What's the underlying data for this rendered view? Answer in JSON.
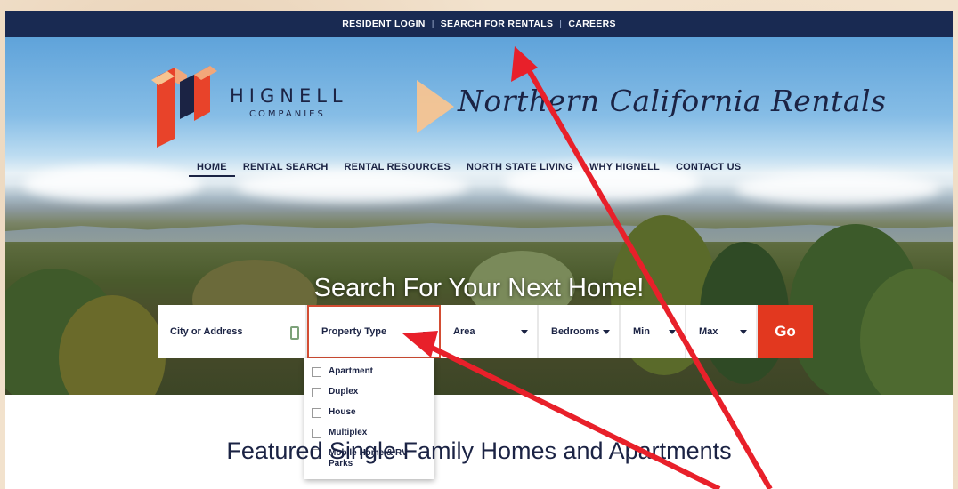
{
  "topbar": {
    "links": [
      "RESIDENT LOGIN",
      "SEARCH FOR RENTALS",
      "CAREERS"
    ],
    "separator": "|"
  },
  "brand": {
    "name": "HIGNELL",
    "sub": "COMPANIES",
    "tagline": "Northern California Rentals"
  },
  "nav": {
    "items": [
      "HOME",
      "RENTAL SEARCH",
      "RENTAL RESOURCES",
      "NORTH STATE LIVING",
      "WHY HIGNELL",
      "CONTACT US"
    ],
    "active": "HOME"
  },
  "hero": {
    "title": "Search For Your Next Home!"
  },
  "search": {
    "city_label": "City or Address",
    "type_label": "Property Type",
    "area_label": "Area",
    "bedrooms_label": "Bedrooms",
    "min_label": "Min",
    "max_label": "Max",
    "go_label": "Go"
  },
  "dropdown": {
    "options": [
      "Apartment",
      "Duplex",
      "House",
      "Multiplex",
      "Mobile Home & RV Parks"
    ]
  },
  "featured": {
    "heading": "Featured Single Family Homes and Apartments"
  },
  "colors": {
    "topbar": "#192a52",
    "navy": "#1b2344",
    "go": "#e2381f",
    "annotation": "#e8202a"
  },
  "icons": [
    "play-icon",
    "location-icon",
    "chevron-down-icon",
    "checkbox-icon",
    "annotation-arrow"
  ]
}
